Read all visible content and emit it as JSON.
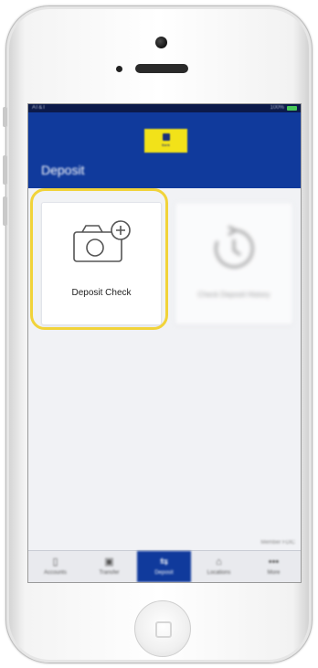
{
  "status_bar": {
    "carrier": "AT&T",
    "right": "100%"
  },
  "nav": {
    "title": "Deposit",
    "logo_text": "Bank"
  },
  "tiles": [
    {
      "label": "Deposit Check",
      "icon": "camera-plus-icon"
    },
    {
      "label": "Check Deposit History",
      "icon": "history-clock-icon"
    }
  ],
  "footer_note": "Member FDIC",
  "tabbar": {
    "items": [
      {
        "label": "Accounts",
        "icon": "phone-icon"
      },
      {
        "label": "Transfer",
        "icon": "transfer-icon"
      },
      {
        "label": "Deposit",
        "icon": "deposit-icon"
      },
      {
        "label": "Locations",
        "icon": "location-icon"
      },
      {
        "label": "More",
        "icon": "more-icon"
      }
    ],
    "active_index": 2
  },
  "colors": {
    "brand_blue": "#103a9c",
    "brand_yellow": "#f2e219",
    "highlight": "#f1d33a",
    "status_bar": "#0c1a4a"
  }
}
